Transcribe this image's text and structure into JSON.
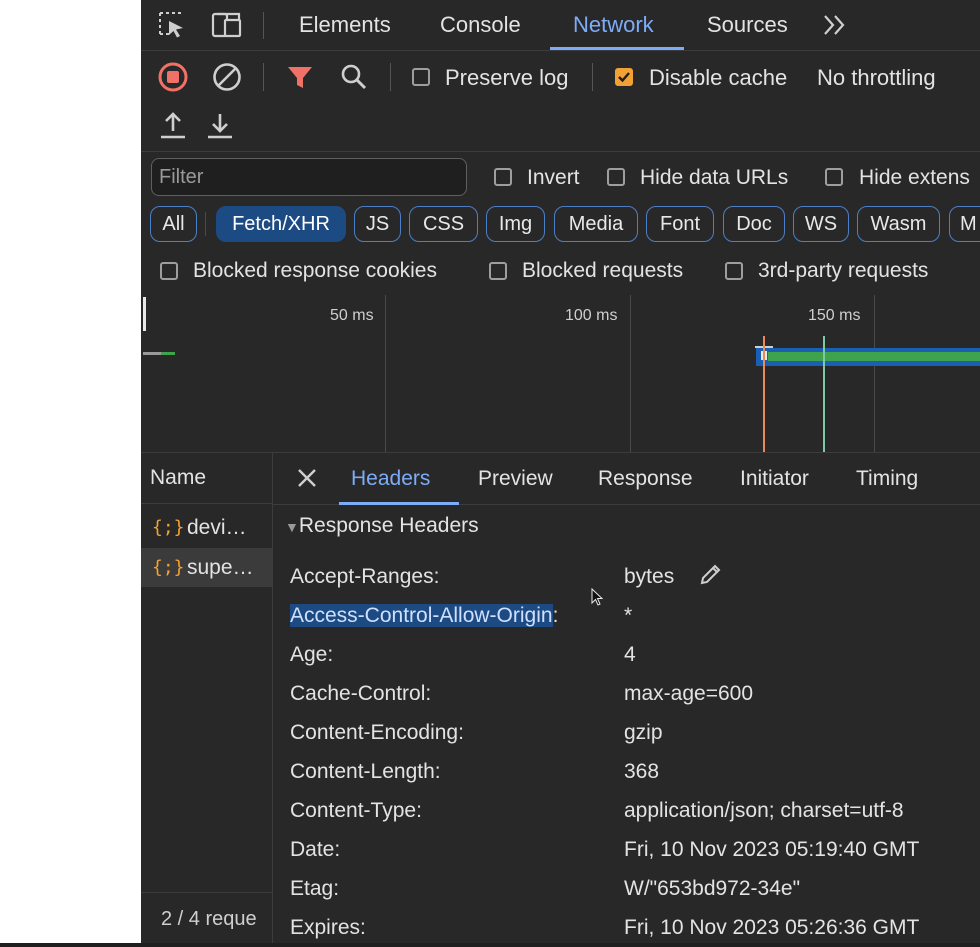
{
  "tabbar": {
    "tabs": [
      {
        "label": "Elements"
      },
      {
        "label": "Console"
      },
      {
        "label": "Network"
      },
      {
        "label": "Sources"
      }
    ],
    "more_icon": "chevron-double-right-icon"
  },
  "toolbar": {
    "preserve_log": {
      "label": "Preserve log",
      "checked": false
    },
    "disable_cache": {
      "label": "Disable cache",
      "checked": true
    },
    "throttling": "No throttling"
  },
  "filter": {
    "placeholder": "Filter",
    "invert": "Invert",
    "hide_data_urls": "Hide data URLs",
    "hide_extensions": "Hide extens",
    "types": [
      "All",
      "Fetch/XHR",
      "JS",
      "CSS",
      "Img",
      "Media",
      "Font",
      "Doc",
      "WS",
      "Wasm",
      "M"
    ],
    "active_type": "Fetch/XHR",
    "blocked_cookies": "Blocked response cookies",
    "blocked_requests": "Blocked requests",
    "third_party": "3rd-party requests"
  },
  "overview": {
    "ticks": [
      "50 ms",
      "100 ms",
      "150 ms"
    ],
    "colors": {
      "bar": "#1a5fb4",
      "bar_fill": "#3fa34d",
      "dom_line": "#7ec8a6",
      "load_line": "#e8895b"
    }
  },
  "name_panel": {
    "header": "Name",
    "requests": [
      {
        "name": "devi…",
        "icon": "{;}"
      },
      {
        "name": "supe…",
        "icon": "{;}"
      }
    ],
    "status": "2 / 4 reque"
  },
  "details": {
    "tabs": [
      "Headers",
      "Preview",
      "Response",
      "Initiator",
      "Timing"
    ],
    "active_tab": "Headers",
    "section": "Response Headers",
    "headers": [
      {
        "name": "Accept-Ranges",
        "value": "bytes"
      },
      {
        "name": "Access-Control-Allow-Origin",
        "value": "*"
      },
      {
        "name": "Age",
        "value": "4"
      },
      {
        "name": "Cache-Control",
        "value": "max-age=600"
      },
      {
        "name": "Content-Encoding",
        "value": "gzip"
      },
      {
        "name": "Content-Length",
        "value": "368"
      },
      {
        "name": "Content-Type",
        "value": "application/json; charset=utf-8"
      },
      {
        "name": "Date",
        "value": "Fri, 10 Nov 2023 05:19:40 GMT"
      },
      {
        "name": "Etag",
        "value": "W/\"653bd972-34e\""
      },
      {
        "name": "Expires",
        "value": "Fri, 10 Nov 2023 05:26:36 GMT"
      }
    ]
  }
}
